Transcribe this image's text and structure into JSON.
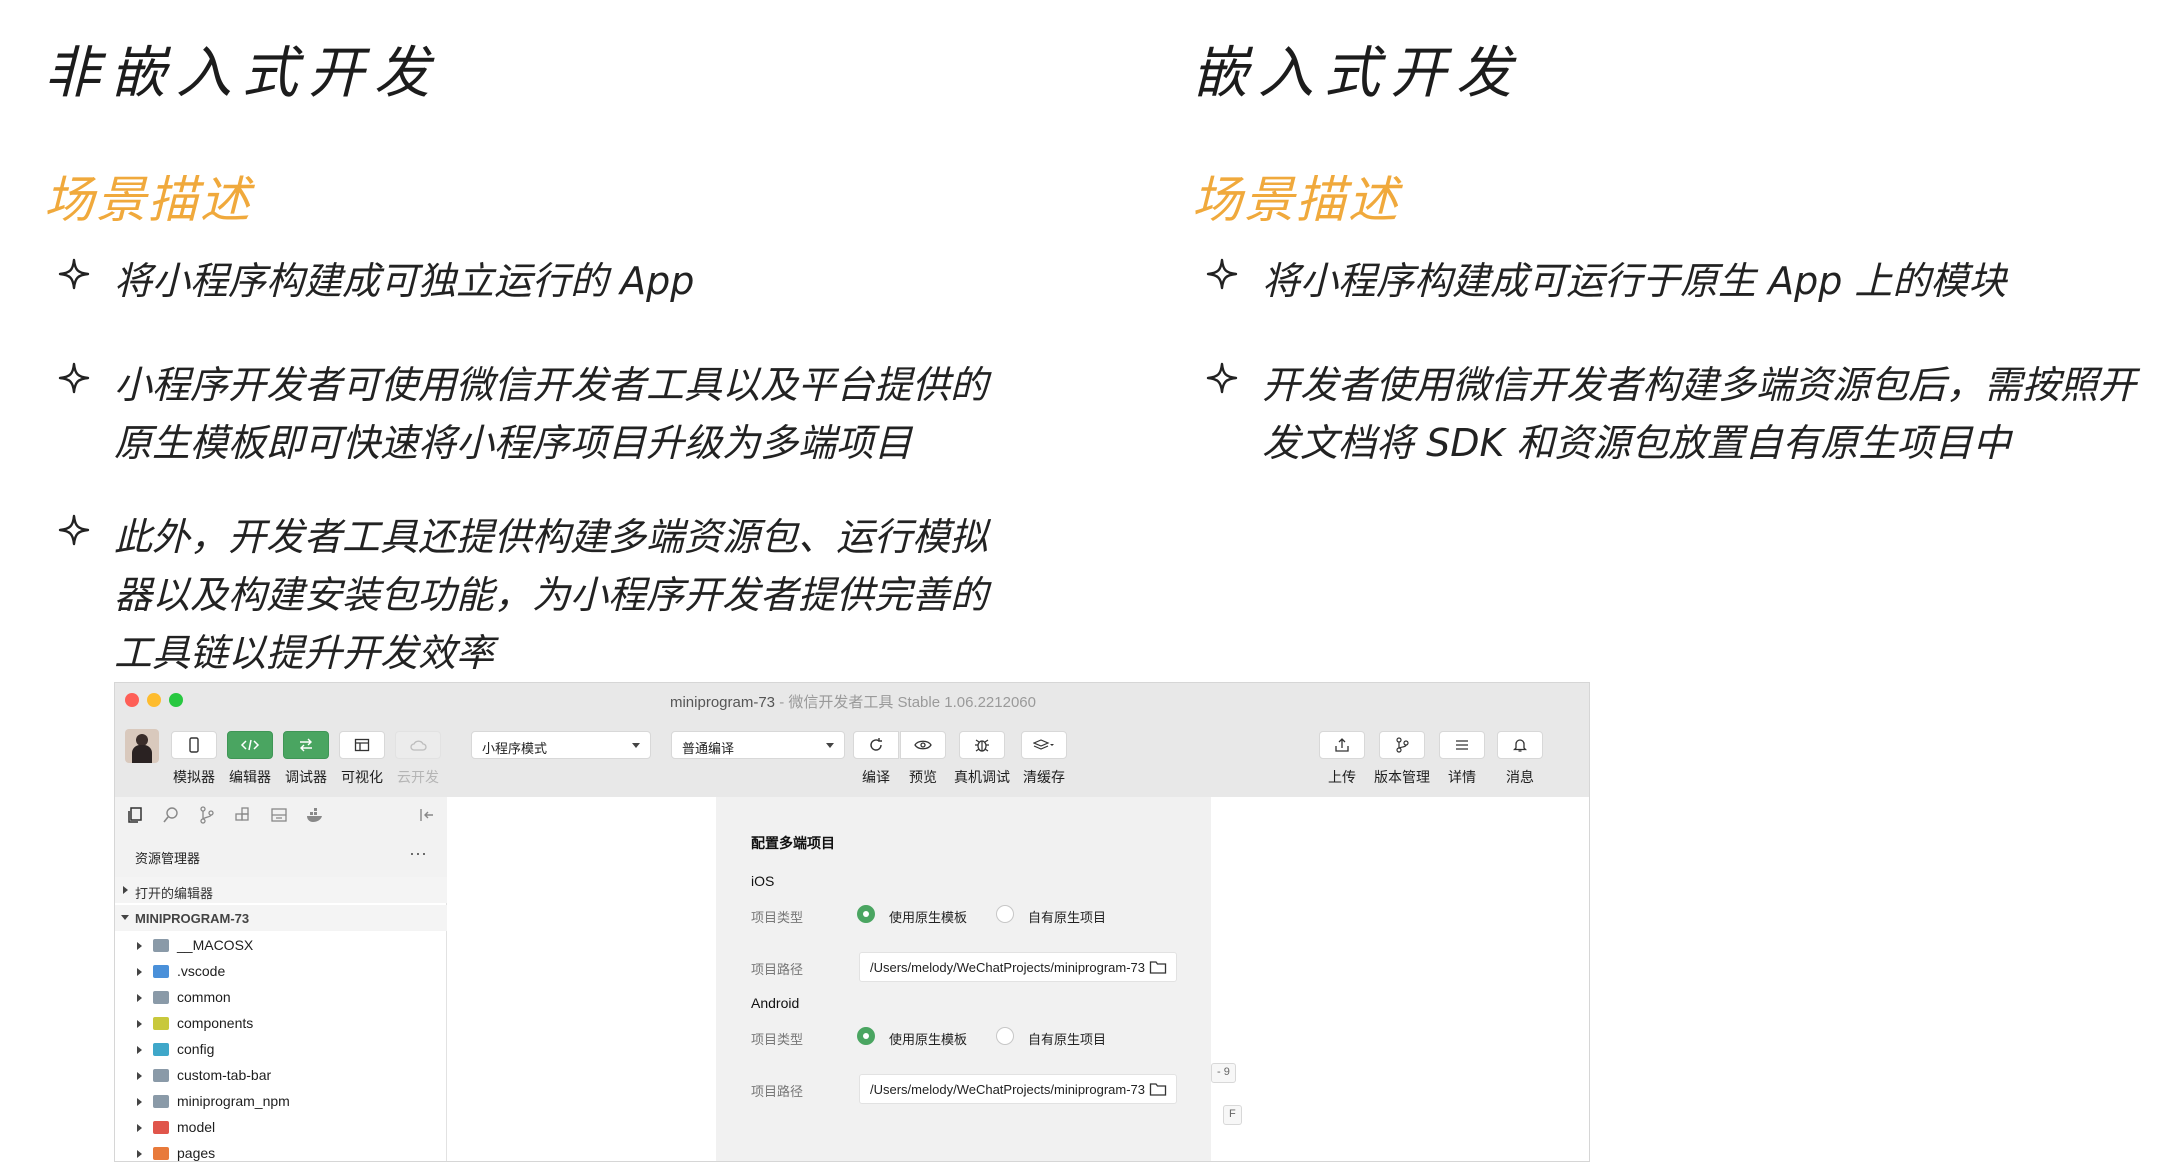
{
  "left": {
    "title": "非嵌入式开发",
    "section": "场景描述",
    "bullets": [
      [
        "将小程序构建成可独立运行的 App"
      ],
      [
        "小程序开发者可使用微信开发者工具以及平台提供的",
        "原生模板即可快速将小程序项目升级为多端项目"
      ],
      [
        "此外，开发者工具还提供构建多端资源包、运行模拟",
        "器以及构建安装包功能，为小程序开发者提供完善的",
        "工具链以提升开发效率"
      ]
    ]
  },
  "right": {
    "title": "嵌入式开发",
    "section": "场景描述",
    "bullets": [
      [
        "将小程序构建成可运行于原生 App 上的模块"
      ],
      [
        "开发者使用微信开发者构建多端资源包后，需按照开",
        "发文档将 SDK 和资源包放置自有原生项目中"
      ]
    ]
  },
  "colors": {
    "accent": "#f0a93c",
    "green": "#4aa561",
    "traffic_red": "#fe5f57",
    "traffic_yellow": "#febc2e",
    "traffic_green": "#28c840"
  },
  "window": {
    "title": "miniprogram-73",
    "subtitle": "- 微信开发者工具 Stable 1.06.2212060",
    "toolbar_left": [
      {
        "label": "模拟器",
        "icon": "phone-icon",
        "active": false
      },
      {
        "label": "编辑器",
        "icon": "code-icon",
        "active": true
      },
      {
        "label": "调试器",
        "icon": "debug-icon",
        "active": true
      },
      {
        "label": "可视化",
        "icon": "layout-icon",
        "active": false
      },
      {
        "label": "云开发",
        "icon": "cloud-icon",
        "active": false
      }
    ],
    "mode_select": "小程序模式",
    "compile_select": "普通编译",
    "toolbar_mid": [
      {
        "label": "编译",
        "icon": "refresh-icon"
      },
      {
        "label": "预览",
        "icon": "eye-icon"
      },
      {
        "label": "真机调试",
        "icon": "bug-icon"
      },
      {
        "label": "清缓存",
        "icon": "layers-icon"
      }
    ],
    "toolbar_right": [
      {
        "label": "上传",
        "icon": "upload-icon"
      },
      {
        "label": "版本管理",
        "icon": "branch-icon"
      },
      {
        "label": "详情",
        "icon": "menu-icon"
      },
      {
        "label": "消息",
        "icon": "bell-icon"
      }
    ],
    "sidebar": {
      "header": "资源管理器",
      "more": "···",
      "open_editors": "打开的编辑器",
      "project": "MINIPROGRAM-73",
      "items": [
        {
          "name": "__MACOSX",
          "color": "#8a9aa8"
        },
        {
          "name": ".vscode",
          "color": "#4a90d9"
        },
        {
          "name": "common",
          "color": "#8a9aa8"
        },
        {
          "name": "components",
          "color": "#c8c83c"
        },
        {
          "name": "config",
          "color": "#3fa7c9"
        },
        {
          "name": "custom-tab-bar",
          "color": "#8a9aa8"
        },
        {
          "name": "miniprogram_npm",
          "color": "#8a9aa8"
        },
        {
          "name": "model",
          "color": "#e0554b"
        },
        {
          "name": "pages",
          "color": "#e87a3b"
        }
      ]
    },
    "panel": {
      "title": "配置多端项目",
      "ios_label": "iOS",
      "android_label": "Android",
      "type_label": "项目类型",
      "path_label": "项目路径",
      "opt_template": "使用原生模板",
      "opt_own": "自有原生项目",
      "ios_path": "/Users/melody/WeChatProjects/miniprogram-73",
      "android_path": "/Users/melody/WeChatProjects/miniprogram-73"
    },
    "keycaps": [
      "- 9",
      "F"
    ]
  }
}
